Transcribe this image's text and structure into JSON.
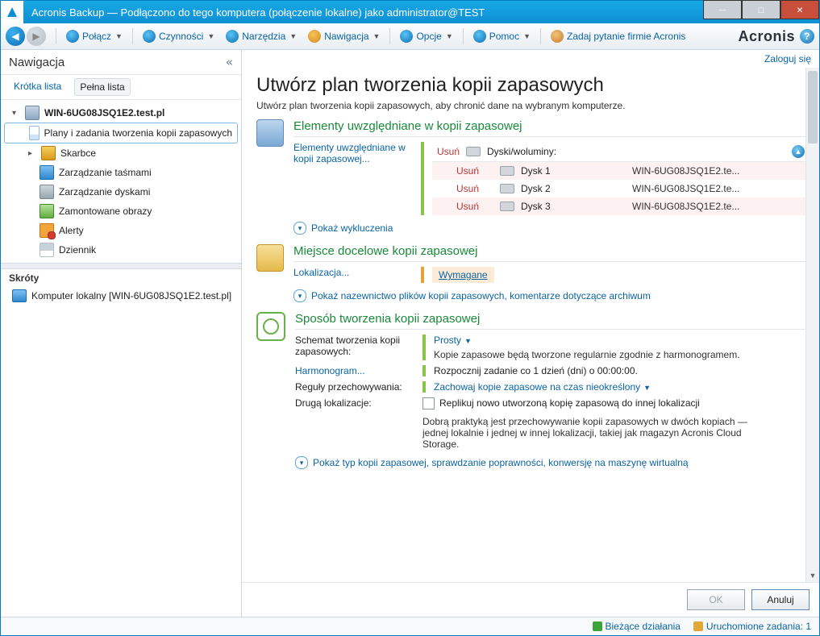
{
  "titlebar": {
    "title": "Acronis Backup — Podłączono do tego komputera (połączenie lokalne) jako administrator@TEST"
  },
  "toolbar": {
    "connect": "Połącz",
    "actions": "Czynności",
    "tools": "Narzędzia",
    "navigation": "Nawigacja",
    "options": "Opcje",
    "help": "Pomoc",
    "ask": "Zadaj pytanie firmie Acronis",
    "brand": "Acronis"
  },
  "sidebar": {
    "title": "Nawigacja",
    "tab_short": "Krótka lista",
    "tab_full": "Pełna lista",
    "root": "WIN-6UG08JSQ1E2.test.pl",
    "items": {
      "plans": "Plany i zadania tworzenia kopii zapasowych",
      "vaults": "Skarbce",
      "tapes": "Zarządzanie taśmami",
      "disks": "Zarządzanie dyskami",
      "images": "Zamontowane obrazy",
      "alerts": "Alerty",
      "log": "Dziennik"
    },
    "shortcuts_head": "Skróty",
    "shortcut_local": "Komputer lokalny [WIN-6UG08JSQ1E2.test.pl]"
  },
  "main": {
    "login": "Zaloguj się",
    "h1": "Utwórz plan tworzenia kopii zapasowych",
    "sub": "Utwórz plan tworzenia kopii zapasowych, aby chronić dane na wybranym komputerze.",
    "sec_items": {
      "title": "Elementy uwzględniane w kopii zapasowej",
      "link": "Elementy uwzględniane w kopii zapasowej...",
      "remove_head": "Usuń",
      "head_label": "Dyski/woluminy:",
      "rows": [
        {
          "rm": "Usuń",
          "name": "Dysk 1",
          "host": "WIN-6UG08JSQ1E2.te..."
        },
        {
          "rm": "Usuń",
          "name": "Dysk 2",
          "host": "WIN-6UG08JSQ1E2.te..."
        },
        {
          "rm": "Usuń",
          "name": "Dysk 3",
          "host": "WIN-6UG08JSQ1E2.te..."
        }
      ],
      "show_excl": "Pokaż wykluczenia"
    },
    "sec_dest": {
      "title": "Miejsce docelowe kopii zapasowej",
      "loc_label": "Lokalizacja...",
      "required": "Wymagane",
      "show_naming": "Pokaż nazewnictwo plików kopii zapasowych, komentarze dotyczące archiwum"
    },
    "sec_how": {
      "title": "Sposób tworzenia kopii zapasowej",
      "scheme_label": "Schemat tworzenia kopii zapasowych:",
      "scheme_value": "Prosty",
      "scheme_desc": "Kopie zapasowe będą tworzone regularnie zgodnie z harmonogramem.",
      "sched_label": "Harmonogram...",
      "sched_value": "Rozpocznij zadanie co 1 dzień (dni) o 00:00:00.",
      "retain_label": "Reguły przechowywania:",
      "retain_value": "Zachowaj kopie zapasowe na czas nieokreślony",
      "secondloc_label": "Drugą lokalizacje:",
      "replicate": "Replikuj nowo utworzoną kopię zapasową do innej lokalizacji",
      "replicate_desc": "Dobrą praktyką jest przechowywanie kopii zapasowych w dwóch kopiach — jednej lokalnie i jednej w innej lokalizacji, takiej jak magazyn Acronis Cloud Storage.",
      "show_type": "Pokaż typ kopii zapasowej, sprawdzanie poprawności, konwersję na maszynę wirtualną"
    },
    "buttons": {
      "ok": "OK",
      "cancel": "Anuluj"
    }
  },
  "statusbar": {
    "current": "Bieżące działania",
    "running": "Uruchomione zadania: 1"
  }
}
